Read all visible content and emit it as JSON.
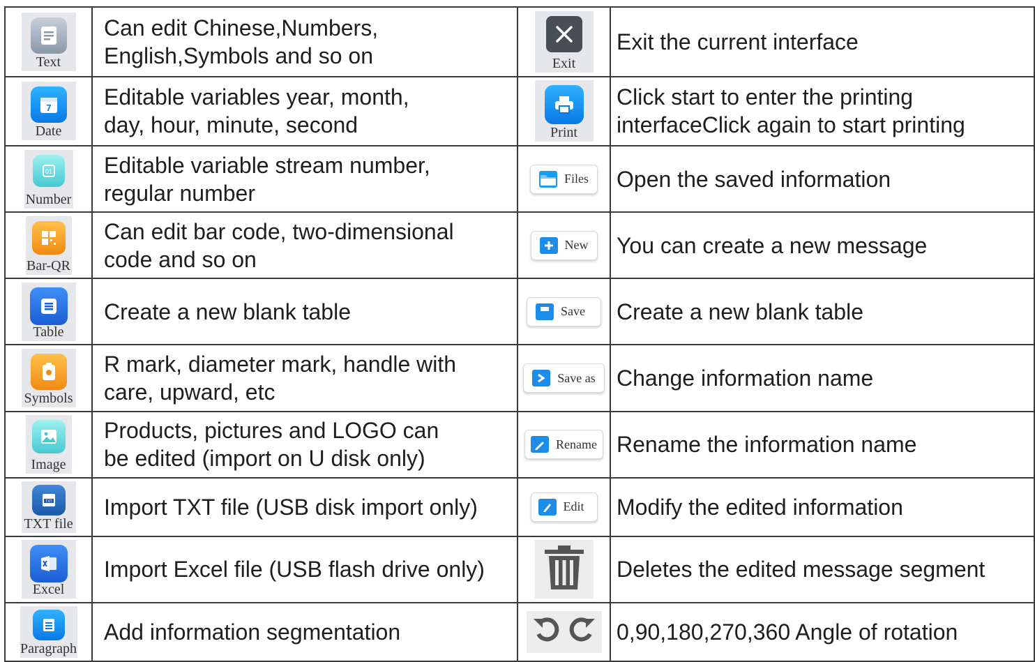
{
  "rows": [
    {
      "left_label": "Text",
      "left_icon": "text-icon",
      "left_desc": "Can edit Chinese,Numbers,\nEnglish,Symbols and so on",
      "right_label": "Exit",
      "right_icon": "close-icon",
      "right_desc": "Exit the current interface"
    },
    {
      "left_label": "Date",
      "left_icon": "calendar-icon",
      "left_desc": "Editable variables year, month,\nday, hour, minute, second",
      "right_label": "Print",
      "right_icon": "printer-icon",
      "right_desc": "Click start to enter the printing\ninterfaceClick again to start printing"
    },
    {
      "left_label": "Number",
      "left_icon": "number-icon",
      "left_desc": "Editable variable stream number,\nregular number",
      "right_label": "Files",
      "right_icon": "folder-icon",
      "right_desc": "Open the saved information"
    },
    {
      "left_label": "Bar-QR",
      "left_icon": "qr-code-icon",
      "left_desc": "Can edit bar code, two-dimensional\ncode and so on",
      "right_label": "New",
      "right_icon": "new-file-icon",
      "right_desc": "You can create a new message"
    },
    {
      "left_label": "Table",
      "left_icon": "table-icon",
      "left_desc": "Create a new blank table",
      "right_label": "Save",
      "right_icon": "save-icon",
      "right_desc": "Create a new blank table"
    },
    {
      "left_label": "Symbols",
      "left_icon": "symbols-icon",
      "left_desc": "R mark, diameter mark, handle with\ncare, upward, etc",
      "right_label": "Save as",
      "right_icon": "save-as-icon",
      "right_desc": "Change information name"
    },
    {
      "left_label": "Image",
      "left_icon": "image-icon",
      "left_desc": "Products, pictures and LOGO can\nbe edited (import on U disk only)",
      "right_label": "Rename",
      "right_icon": "rename-icon",
      "right_desc": "Rename the information name"
    },
    {
      "left_label": "TXT file",
      "left_icon": "txt-file-icon",
      "left_desc": "Import TXT file (USB disk import only)",
      "right_label": "Edit",
      "right_icon": "edit-icon",
      "right_desc": "Modify the edited information"
    },
    {
      "left_label": "Excel",
      "left_icon": "excel-icon",
      "left_desc": "Import Excel file (USB flash drive only)",
      "right_label": "",
      "right_icon": "trash-icon",
      "right_desc": "Deletes the edited message segment"
    },
    {
      "left_label": "Paragraph",
      "left_icon": "paragraph-icon",
      "left_desc": "Add information segmentation",
      "right_label": "",
      "right_icon": "rotate-icon",
      "right_desc": "0,90,180,270,360 Angle of rotation"
    }
  ]
}
